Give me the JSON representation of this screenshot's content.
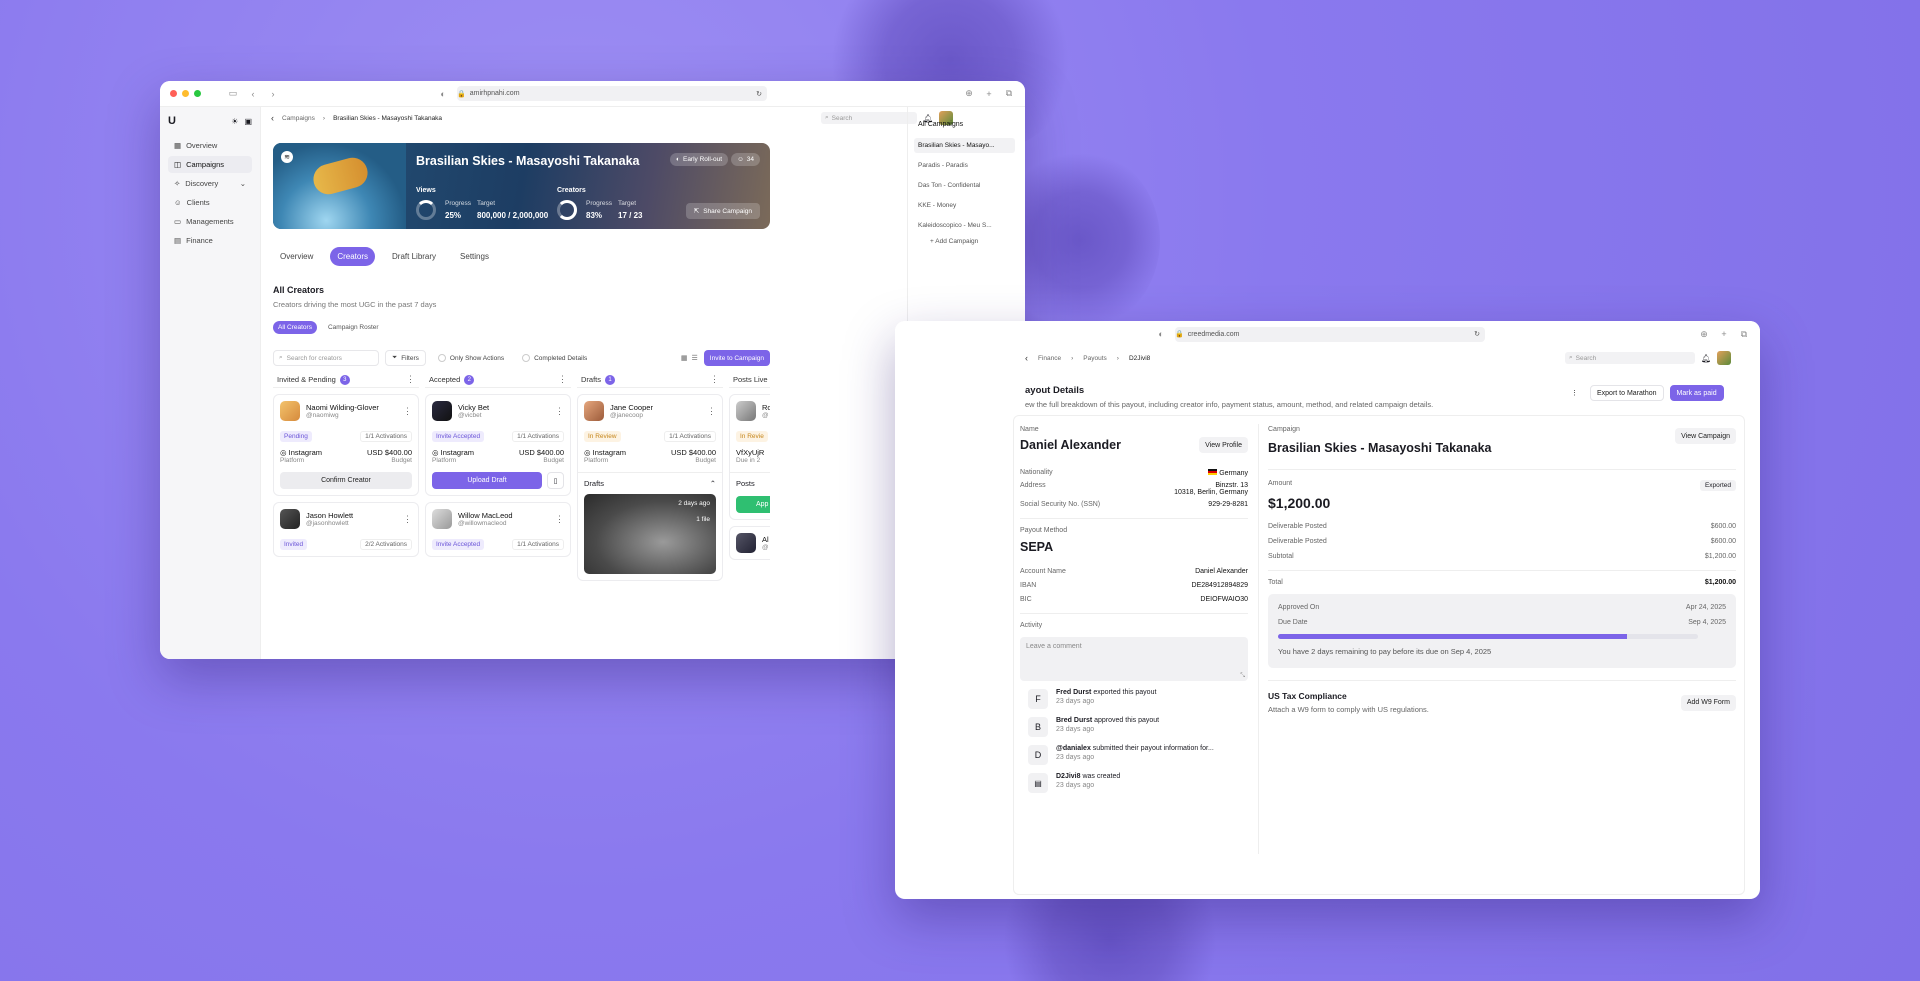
{
  "colors": {
    "accent": "#7c64e8",
    "background": "#8f7ef0"
  },
  "window1": {
    "url": "amirhpnahi.com",
    "sidebar": {
      "logo": "U",
      "items": [
        {
          "label": "Overview",
          "icon": "grid-icon"
        },
        {
          "label": "Campaigns",
          "icon": "megaphone-icon"
        },
        {
          "label": "Discovery",
          "icon": "compass-icon"
        },
        {
          "label": "Clients",
          "icon": "users-icon"
        },
        {
          "label": "Managements",
          "icon": "briefcase-icon"
        },
        {
          "label": "Finance",
          "icon": "wallet-icon"
        }
      ]
    },
    "breadcrumb": {
      "parent": "Campaigns",
      "current": "Brasilian Skies - Masayoshi Takanaka"
    },
    "search_placeholder": "Search",
    "banner": {
      "title": "Brasilian Skies - Masayoshi Takanaka",
      "pill_status": "Early Roll-out",
      "pill_count": "34",
      "views": {
        "heading": "Views",
        "progress_label": "Progress",
        "progress": "25%",
        "target_label": "Target",
        "target": "800,000 / 2,000,000"
      },
      "creators": {
        "heading": "Creators",
        "progress_label": "Progress",
        "progress": "83%",
        "target_label": "Target",
        "target": "17 / 23"
      },
      "share_label": "Share Campaign"
    },
    "tabs": [
      "Overview",
      "Creators",
      "Draft Library",
      "Settings"
    ],
    "section": {
      "title": "All Creators",
      "subtitle": "Creators driving the most UGC in the past 7 days"
    },
    "subtabs": [
      "All Creators",
      "Campaign Roster"
    ],
    "toolbar": {
      "search_placeholder": "Search for creators",
      "filters": "Filters",
      "only_show_actions": "Only Show Actions",
      "completed_details": "Completed Details",
      "invite": "Invite to Campaign"
    },
    "columns": [
      {
        "title": "Invited & Pending",
        "count": "3",
        "cards": [
          {
            "name": "Naomi Wilding-Glover",
            "handle": "@naomiwg",
            "status": "Pending",
            "activations": "1/1 Activations",
            "platform": "Instagram",
            "platform_label": "Platform",
            "budget": "USD $400.00",
            "budget_label": "Budget",
            "action": "Confirm Creator"
          },
          {
            "name": "Jason Howlett",
            "handle": "@jasonhowlett",
            "status": "Invited",
            "activations": "2/2 Activations"
          }
        ]
      },
      {
        "title": "Accepted",
        "count": "2",
        "cards": [
          {
            "name": "Vicky Bet",
            "handle": "@vicbet",
            "status": "Invite Accepted",
            "activations": "1/1 Activations",
            "platform": "Instagram",
            "platform_label": "Platform",
            "budget": "USD $400.00",
            "budget_label": "Budget",
            "action": "Upload Draft"
          },
          {
            "name": "Willow MacLeod",
            "handle": "@willowmacleod",
            "status": "Invite Accepted",
            "activations": "1/1 Activations"
          }
        ]
      },
      {
        "title": "Drafts",
        "count": "1",
        "cards": [
          {
            "name": "Jane Cooper",
            "handle": "@janecoop",
            "status": "In Review",
            "activations": "1/1 Activations",
            "platform": "Instagram",
            "platform_label": "Platform",
            "budget": "USD $400.00",
            "budget_label": "Budget",
            "drafts_label": "Drafts",
            "draft_time": "2 days ago",
            "draft_files": "1 file"
          }
        ]
      },
      {
        "title": "Posts Live",
        "cards": [
          {
            "name": "Ro",
            "handle": "@",
            "status": "In Revie",
            "code": "VfXyUjR",
            "due": "Due in 2",
            "posts_label": "Posts",
            "action": "App"
          },
          {
            "name": "Al",
            "handle": "@"
          }
        ]
      }
    ],
    "right_panel": {
      "heading": "All Campaigns",
      "items": [
        "Brasilian Skies - Masayo...",
        "Paradis - Paradis",
        "Das Ton - Confidental",
        "KKE - Money",
        "Kaleidoscopico - Meu S..."
      ],
      "add": "Add Campaign"
    }
  },
  "window2": {
    "url": "creedmedia.com",
    "breadcrumb": [
      "Finance",
      "Payouts",
      "D2Jivi8"
    ],
    "search_placeholder": "Search",
    "page_title": "ayout Details",
    "page_subtitle": "ew the full breakdown of this payout, including creator info, payment status, amount, method, and related campaign details.",
    "export_label": "Export to Marathon",
    "mark_paid_label": "Mark as paid",
    "creator": {
      "name_label": "Name",
      "name": "Daniel Alexander",
      "view_profile": "View Profile",
      "nationality_label": "Nationality",
      "nationality": "Germany",
      "address_label": "Address",
      "address_line1": "Binzstr. 13",
      "address_line2": "10318, Berlin, Germany",
      "ssn_label": "Social Security No. (SSN)",
      "ssn": "929-29-8281"
    },
    "payout_method": {
      "label": "Payout Method",
      "method": "SEPA",
      "account_name_label": "Account Name",
      "account_name": "Daniel Alexander",
      "iban_label": "IBAN",
      "iban": "DE284912894829",
      "bic_label": "BIC",
      "bic": "DEIOFWAIO30"
    },
    "activity": {
      "label": "Activity",
      "comment_placeholder": "Leave a comment",
      "items": [
        {
          "initial": "F",
          "actor": "Fred Durst",
          "text": "exported this payout",
          "time": "23 days ago"
        },
        {
          "initial": "B",
          "actor": "Bred Durst",
          "text": "approved this payout",
          "time": "23 days ago"
        },
        {
          "initial": "D",
          "actor": "@danialex",
          "text": "submitted their payout information for...",
          "time": "23 days ago"
        },
        {
          "initial": "",
          "actor": "D2Jivi8",
          "text": "was created",
          "time": "23 days ago"
        }
      ]
    },
    "campaign": {
      "label": "Campaign",
      "name": "Brasilian Skies - Masayoshi Takanaka",
      "view_campaign": "View Campaign",
      "amount_label": "Amount",
      "amount": "$1,200.00",
      "status": "Exported",
      "lines": [
        {
          "label": "Deliverable Posted",
          "value": "$600.00"
        },
        {
          "label": "Deliverable Posted",
          "value": "$600.00"
        },
        {
          "label": "Subtotal",
          "value": "$1,200.00"
        }
      ],
      "total_label": "Total",
      "total": "$1,200.00",
      "approved_label": "Approved On",
      "approved": "Apr 24, 2025",
      "due_label": "Due Date",
      "due": "Sep 4, 2025",
      "due_progress": 0.83,
      "due_note": "You have 2 days remaining to pay before its due on Sep 4, 2025"
    },
    "tax": {
      "title": "US Tax Compliance",
      "subtitle": "Attach a W9 form to comply with US regulations.",
      "button": "Add W9 Form"
    }
  }
}
